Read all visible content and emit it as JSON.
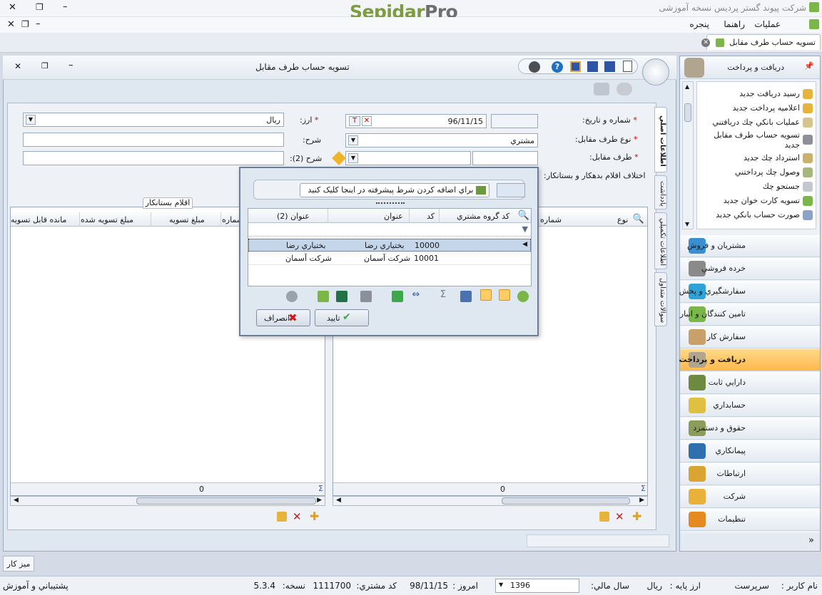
{
  "titlebar": {
    "app_title": "شرکت پیوند گستر پردیس نسخه آموزشی",
    "logo_main": "Sepidar",
    "logo_pro": "Pro"
  },
  "menu": {
    "operations": "عمليات",
    "help": "راهنما",
    "window": "پنجره"
  },
  "tab": {
    "title": "تسويه حساب طرف مقابل"
  },
  "window": {
    "title": "تسويه حساب طرف مقابل"
  },
  "form": {
    "number_date_label": "شماره و تاريخ:",
    "date_value": "96/11/15",
    "currency_label": "ارز:",
    "currency_value": "ريال",
    "party_type_label": "نوع طرف مقابل:",
    "party_type_value": "مشتري",
    "description_label": "شرح:",
    "party_label": "طرف مقابل:",
    "description2_label": "شرح (2):",
    "difference_label": "اختلاف اقلام بدهکار و بستانکار:"
  },
  "vertical_tabs": [
    "اطلاعات اصلي",
    "يادداشت",
    "اطلاعات تکميلي",
    "سوالات متداول"
  ],
  "left_grid": {
    "group_tab": "اقلام بستانکار",
    "columns": [
      "شماره",
      "مبلغ تسويه",
      "مبلغ تسويه شده",
      "مانده قابل تسويه"
    ],
    "footer_total": "0"
  },
  "right_grid": {
    "columns": [
      "نوع",
      "شماره"
    ],
    "footer_total": "0"
  },
  "dialog": {
    "advanced_filter": "براي اضافه کردن شرط پيشرفته در اينجا کليک کنيد",
    "columns": [
      "کد گروه مشتري",
      "کد",
      "عنوان",
      "عنوان (2)"
    ],
    "rows": [
      {
        "code": "10000",
        "title": "بختياري رضا",
        "title2": "بختياري رضا"
      },
      {
        "code": "10001",
        "title": "شرکت آسمان",
        "title2": "شرکت آسمان"
      }
    ],
    "ok": "تاييد",
    "cancel": "انصراف"
  },
  "sidebar": {
    "header": "دريافت و پرداخت",
    "tasks": [
      "رسيد دريافت جديد",
      "اعلاميه پرداخت جديد",
      "عمليات بانکي چك دريافتني",
      "تسويه حساب طرف مقابل جديد",
      "استرداد چك جديد",
      "وصول چك پرداختني",
      "جستجو چك",
      "تسويه کارت خوان جديد",
      "صورت حساب بانکي جديد"
    ],
    "nav": [
      {
        "label": "مشتريان و فروش",
        "color": "#3a8fd0"
      },
      {
        "label": "خرده فروشي",
        "color": "#8a8a8a"
      },
      {
        "label": "سفارشگيري و پخش",
        "color": "#2fa3d6"
      },
      {
        "label": "تامين کنندگان و انبار",
        "color": "#7ab648"
      },
      {
        "label": "سفارش کار",
        "color": "#c9a06a"
      },
      {
        "label": "دريافت و پرداخت",
        "color": "#b0a58f",
        "active": true
      },
      {
        "label": "دارايي ثابت",
        "color": "#6d8a3e"
      },
      {
        "label": "حسابداري",
        "color": "#e0c040"
      },
      {
        "label": "حقوق و دستمزد",
        "color": "#8a9e5a"
      },
      {
        "label": "پيمانکاري",
        "color": "#2e6fb0"
      },
      {
        "label": "ارتباطات",
        "color": "#d9a530"
      },
      {
        "label": "شرکت",
        "color": "#e9b13a"
      },
      {
        "label": "تنظيمات",
        "color": "#e58a20"
      }
    ]
  },
  "desktop_tab": "ميز کار",
  "status": {
    "user_label": "نام کاربر :",
    "user_value": "سرپرست",
    "base_currency_label": "ارز پايه :",
    "base_currency_value": "ريال",
    "fiscal_year_label": "سال مالي:",
    "fiscal_year_value": "1396",
    "today_label": "امروز :",
    "today_value": "98/11/15",
    "customer_code_label": "کد مشتري:",
    "customer_code_value": "1111700",
    "version_label": "نسخه:",
    "version_value": "5.3.4",
    "support": "پشتيباني و آموزش"
  }
}
